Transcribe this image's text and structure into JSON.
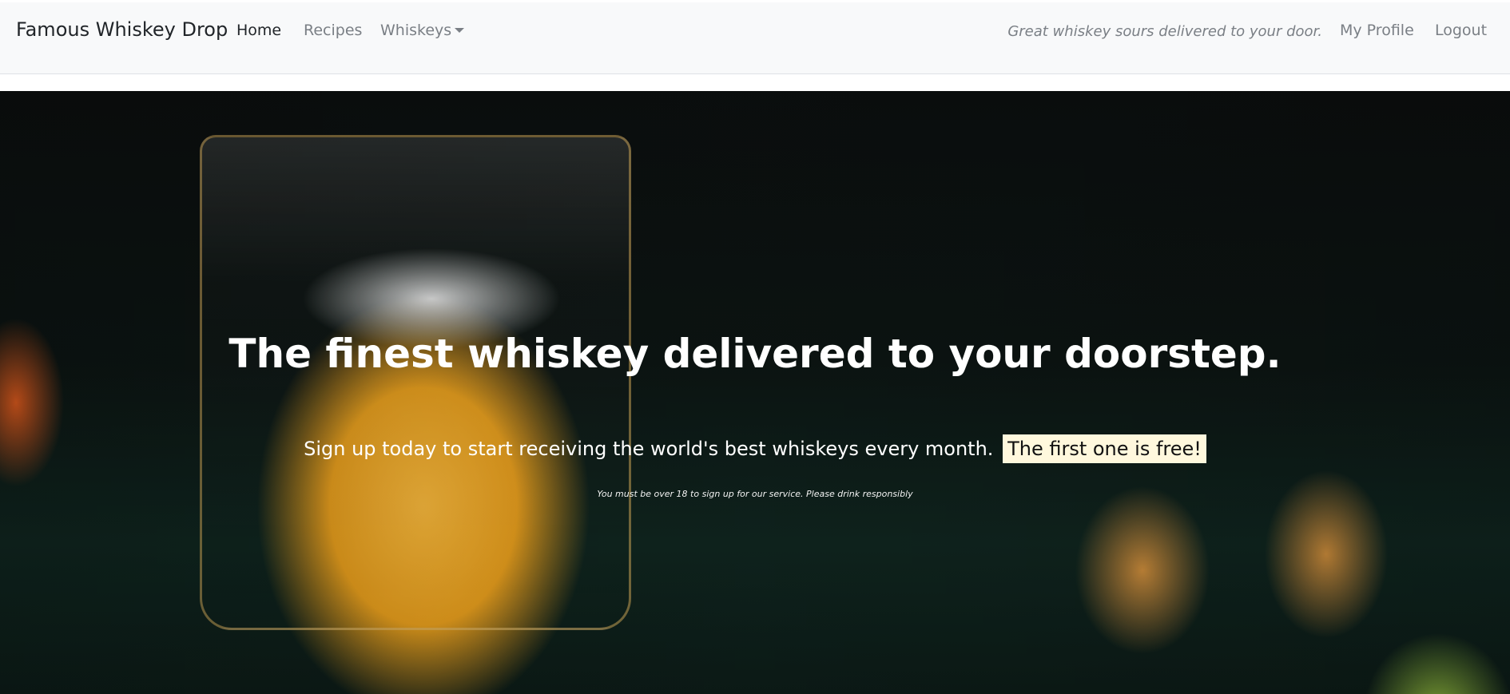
{
  "navbar": {
    "brand": "Famous Whiskey Drop",
    "links": [
      {
        "label": "Home",
        "active": true
      },
      {
        "label": "Recipes",
        "active": false
      },
      {
        "label": "Whiskeys",
        "active": false,
        "dropdown": true
      }
    ],
    "tagline": "Great whiskey sours delivered to your door.",
    "profile_label": "My Profile",
    "logout_label": "Logout"
  },
  "hero": {
    "title": "The finest whiskey delivered to your doorstep.",
    "subtitle": "Sign up today to start receiving the world's best whiskeys every month.",
    "highlight": "The first one is free!",
    "disclaimer": "You must be over 18 to sign up for our service. Please drink responsibly"
  },
  "colors": {
    "navbar_bg": "#f8f9fa",
    "nav_text": "#7a7f85",
    "highlight_bg": "#fff8dd"
  }
}
